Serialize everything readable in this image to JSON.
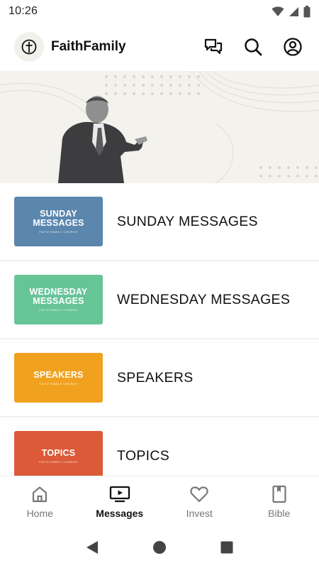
{
  "status_bar": {
    "time": "10:26",
    "icons": [
      "wifi-icon",
      "signal-icon",
      "battery-icon"
    ]
  },
  "header": {
    "app_name": "FaithFamily",
    "actions": [
      "chat-icon",
      "search-icon",
      "account-icon"
    ]
  },
  "banner": {
    "image": "speaker-gesturing-photo"
  },
  "list": {
    "items": [
      {
        "thumb_title_1": "SUNDAY",
        "thumb_title_2": "MESSAGES",
        "thumb_sub": "FAITH FAMILY CHURCH",
        "label": "SUNDAY MESSAGES",
        "color": "#5b86ad"
      },
      {
        "thumb_title_1": "WEDNESDAY",
        "thumb_title_2": "MESSAGES",
        "thumb_sub": "FAITH FAMILY CHURCH",
        "label": "WEDNESDAY MESSAGES",
        "color": "#67c497"
      },
      {
        "thumb_title_1": "SPEAKERS",
        "thumb_title_2": "",
        "thumb_sub": "FAITH FAMILY CHURCH",
        "label": "SPEAKERS",
        "color": "#f0a21e"
      },
      {
        "thumb_title_1": "TOPICS",
        "thumb_title_2": "",
        "thumb_sub": "FAITH FAMILY CHURCH",
        "label": "TOPICS",
        "color": "#dc5a38"
      }
    ]
  },
  "bottom_nav": {
    "items": [
      {
        "label": "Home",
        "icon": "home-icon",
        "active": false
      },
      {
        "label": "Messages",
        "icon": "video-icon",
        "active": true
      },
      {
        "label": "Invest",
        "icon": "heart-icon",
        "active": false
      },
      {
        "label": "Bible",
        "icon": "book-icon",
        "active": false
      }
    ]
  },
  "system_nav": [
    "back-icon",
    "home-circle-icon",
    "recents-icon"
  ]
}
